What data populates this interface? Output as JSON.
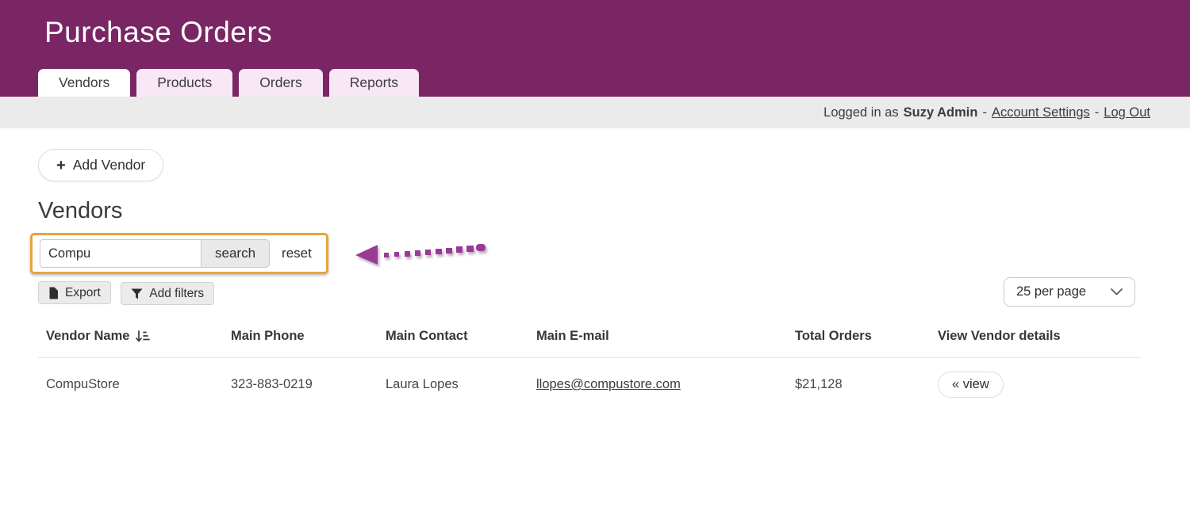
{
  "colors": {
    "header_purple": "#7a2664",
    "tab_inactive_pink": "#f8e7f5",
    "userbar_gray": "#ebebeb",
    "highlight_gold": "#e8a43b",
    "annotation_purple": "#9a3a96"
  },
  "header": {
    "title": "Purchase Orders",
    "tabs": [
      {
        "label": "Vendors",
        "active": true
      },
      {
        "label": "Products",
        "active": false
      },
      {
        "label": "Orders",
        "active": false
      },
      {
        "label": "Reports",
        "active": false
      }
    ]
  },
  "userbar": {
    "prefix": "Logged in as",
    "username": "Suzy Admin",
    "separator": "-",
    "account_settings_label": "Account Settings",
    "logout_label": "Log Out"
  },
  "actions": {
    "plus_icon": "+",
    "add_vendor_label": "Add Vendor",
    "export_label": "Export",
    "add_filters_label": "Add filters"
  },
  "page": {
    "heading": "Vendors"
  },
  "search": {
    "input_value": "Compu",
    "search_button_label": "search",
    "reset_label": "reset"
  },
  "pagination": {
    "per_page": "25 per page"
  },
  "table": {
    "columns": [
      "Vendor Name",
      "Main Phone",
      "Main Contact",
      "Main E-mail",
      "Total Orders",
      "View Vendor details"
    ],
    "rows": [
      {
        "vendor_name": "CompuStore",
        "main_phone": "323-883-0219",
        "main_contact": "Laura Lopes",
        "main_email": "llopes@compustore.com",
        "total_orders": "$21,128",
        "view_label": "« view"
      }
    ]
  }
}
